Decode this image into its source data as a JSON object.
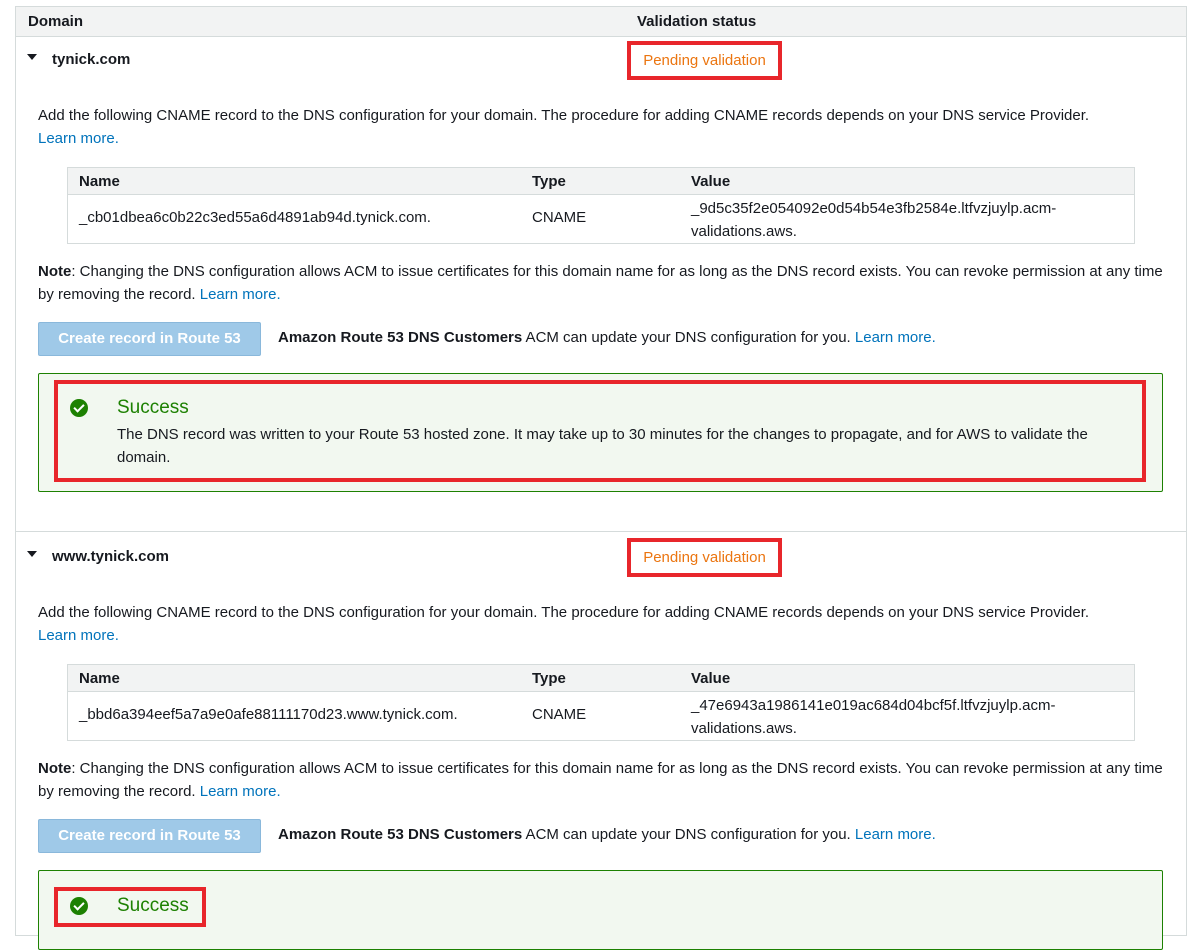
{
  "header": {
    "domain_col": "Domain",
    "status_col": "Validation status"
  },
  "sections": [
    {
      "domain": "tynick.com",
      "status": "Pending validation",
      "instruction": "Add the following CNAME record to the DNS configuration for your domain. The procedure for adding CNAME records depends on your DNS service Provider.",
      "learn_more": "Learn more.",
      "table": {
        "headers": {
          "name": "Name",
          "type": "Type",
          "value": "Value"
        },
        "row": {
          "name": "_cb01dbea6c0b22c3ed55a6d4891ab94d.tynick.com.",
          "type": "CNAME",
          "value": "_9d5c35f2e054092e0d54b54e3fb2584e.ltfvzjuylp.acm-validations.aws."
        }
      },
      "note_label": "Note",
      "note_text": ": Changing the DNS configuration allows ACM to issue certificates for this domain name for as long as the DNS record exists. You can revoke permission at any time by removing the record.",
      "note_link": "Learn more.",
      "r53_button": "Create record in Route 53",
      "r53_bold": "Amazon Route 53 DNS Customers",
      "r53_text": " ACM can update your DNS configuration for you.",
      "r53_link": "Learn more.",
      "success_title": "Success",
      "success_msg": "The DNS record was written to your Route 53 hosted zone. It may take up to 30 minutes for the changes to propagate, and for AWS to validate the domain."
    },
    {
      "domain": "www.tynick.com",
      "status": "Pending validation",
      "instruction": "Add the following CNAME record to the DNS configuration for your domain. The procedure for adding CNAME records depends on your DNS service Provider.",
      "learn_more": "Learn more.",
      "table": {
        "headers": {
          "name": "Name",
          "type": "Type",
          "value": "Value"
        },
        "row": {
          "name": "_bbd6a394eef5a7a9e0afe88111170d23.www.tynick.com.",
          "type": "CNAME",
          "value": "_47e6943a1986141e019ac684d04bcf5f.ltfvzjuylp.acm-validations.aws."
        }
      },
      "note_label": "Note",
      "note_text": ": Changing the DNS configuration allows ACM to issue certificates for this domain name for as long as the DNS record exists. You can revoke permission at any time by removing the record.",
      "note_link": "Learn more.",
      "r53_button": "Create record in Route 53",
      "r53_bold": "Amazon Route 53 DNS Customers",
      "r53_text": " ACM can update your DNS configuration for you.",
      "r53_link": "Learn more.",
      "success_title": "Success"
    }
  ],
  "colors": {
    "pending": "#eb7510",
    "success": "#1d8102",
    "link": "#0073bb",
    "highlight": "#e8262b"
  }
}
